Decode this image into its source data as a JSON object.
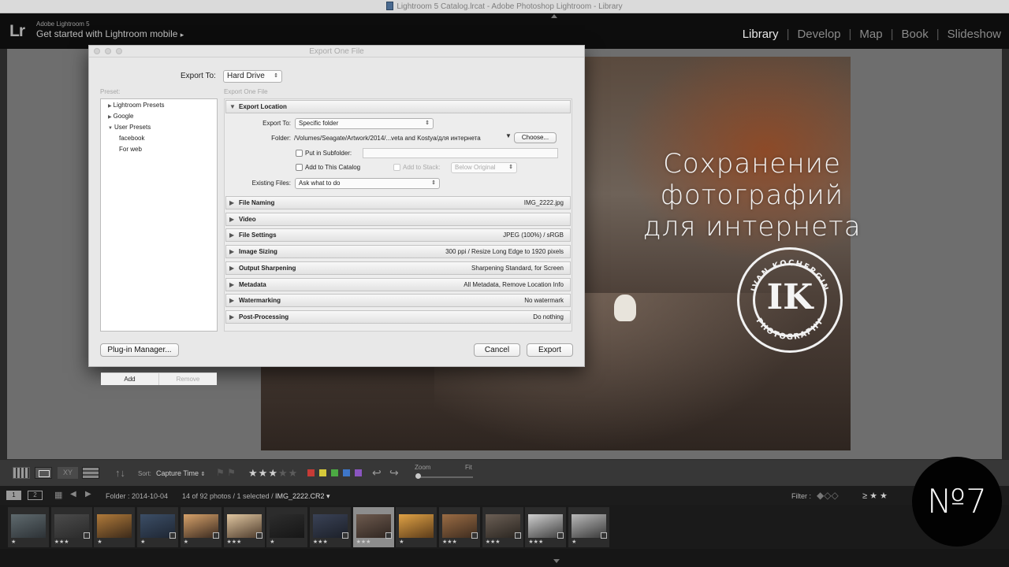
{
  "window": {
    "title": "Lightroom 5 Catalog.lrcat - Adobe Photoshop Lightroom - Library"
  },
  "identity": {
    "logo": "Lr",
    "product": "Adobe Lightroom 5",
    "mobile": "Get started with Lightroom mobile",
    "mobile_arrow": "▸"
  },
  "modules": [
    "Library",
    "Develop",
    "Map",
    "Book",
    "Slideshow"
  ],
  "active_module": "Library",
  "overlay": {
    "line1": "Сохранение фотографий",
    "line2": "для интернета",
    "badge": "№7",
    "logo_initials": "IK",
    "logo_top_text": "IVAN KOCHERGIN",
    "logo_bottom_text": "PHOTOGRAPHY"
  },
  "dialog": {
    "title": "Export One File",
    "export_to_label": "Export To:",
    "export_to_value": "Hard Drive",
    "preset_label": "Preset:",
    "subtitle": "Export One File",
    "presets": [
      {
        "label": "Lightroom Presets",
        "expanded": false,
        "indent": 0
      },
      {
        "label": "Google",
        "expanded": false,
        "indent": 0
      },
      {
        "label": "User Presets",
        "expanded": true,
        "indent": 0
      },
      {
        "label": "facebook",
        "indent": 1
      },
      {
        "label": "For web",
        "indent": 1
      }
    ],
    "add_label": "Add",
    "remove_label": "Remove",
    "export_location": {
      "title": "Export Location",
      "export_to_label": "Export To:",
      "export_to_value": "Specific folder",
      "folder_label": "Folder:",
      "folder_value": "/Volumes/Seagate/Artwork/2014/...veta and Kostya/для интернета",
      "choose_label": "Choose...",
      "subfolder_label": "Put in Subfolder:",
      "add_catalog_label": "Add to This Catalog",
      "add_stack_label": "Add to Stack:",
      "stack_value": "Below Original",
      "existing_label": "Existing Files:",
      "existing_value": "Ask what to do"
    },
    "sections": [
      {
        "title": "File Naming",
        "summary": "IMG_2222.jpg"
      },
      {
        "title": "Video",
        "summary": ""
      },
      {
        "title": "File Settings",
        "summary": "JPEG (100%) / sRGB"
      },
      {
        "title": "Image Sizing",
        "summary": "300 ppi / Resize Long Edge to 1920 pixels"
      },
      {
        "title": "Output Sharpening",
        "summary": "Sharpening Standard, for Screen"
      },
      {
        "title": "Metadata",
        "summary": "All Metadata, Remove Location Info"
      },
      {
        "title": "Watermarking",
        "summary": "No watermark"
      },
      {
        "title": "Post-Processing",
        "summary": "Do nothing"
      }
    ],
    "plugin_label": "Plug-in Manager...",
    "cancel_label": "Cancel",
    "export_label": "Export"
  },
  "toolbar": {
    "sort_label": "Sort:",
    "sort_value": "Capture Time",
    "rating_stars": 3,
    "zoom_label": "Zoom",
    "fit_label": "Fit",
    "colors": [
      "#c63b36",
      "#d6c93a",
      "#4caa43",
      "#3e76c8",
      "#8a55c0"
    ]
  },
  "filmbar": {
    "screen1": "1",
    "screen2": "2",
    "folder": "Folder : 2014-10-04",
    "info": "14 of 92 photos / 1 selected /",
    "file": "IMG_2222.CR2 ▾",
    "filter_label": "Filter :",
    "filter_op": "≥"
  },
  "thumbnails": [
    {
      "rating": "★",
      "c1": "#5f6a6e",
      "c2": "#2d3236",
      "badge": false
    },
    {
      "rating": "★★★",
      "c1": "#4b4b4b",
      "c2": "#2a2a2a",
      "badge": true
    },
    {
      "rating": "★",
      "c1": "#b07a3a",
      "c2": "#3c2a1a",
      "badge": false
    },
    {
      "rating": "★",
      "c1": "#3c4e66",
      "c2": "#1e2633",
      "badge": true
    },
    {
      "rating": "★",
      "c1": "#d7a26a",
      "c2": "#3a2a20",
      "badge": true
    },
    {
      "rating": "★★★",
      "c1": "#e0c6a0",
      "c2": "#4d3b2c",
      "badge": true
    },
    {
      "rating": "★",
      "c1": "#2d2d2d",
      "c2": "#161616",
      "badge": false
    },
    {
      "rating": "★★★",
      "c1": "#3a4256",
      "c2": "#1c2029",
      "badge": true
    },
    {
      "rating": "★★★",
      "c1": "#6d5a4e",
      "c2": "#2f2520",
      "badge": true,
      "selected": true
    },
    {
      "rating": "★",
      "c1": "#e0a245",
      "c2": "#5c3c1a",
      "badge": false
    },
    {
      "rating": "★★★",
      "c1": "#9a6c44",
      "c2": "#3e2c1f",
      "badge": true
    },
    {
      "rating": "★★★",
      "c1": "#6b5f55",
      "c2": "#2a2520",
      "badge": true
    },
    {
      "rating": "★★★",
      "c1": "#cfcfcf",
      "c2": "#404040",
      "badge": true
    },
    {
      "rating": "★",
      "c1": "#b9b9b9",
      "c2": "#3a3a3a",
      "badge": true
    }
  ]
}
